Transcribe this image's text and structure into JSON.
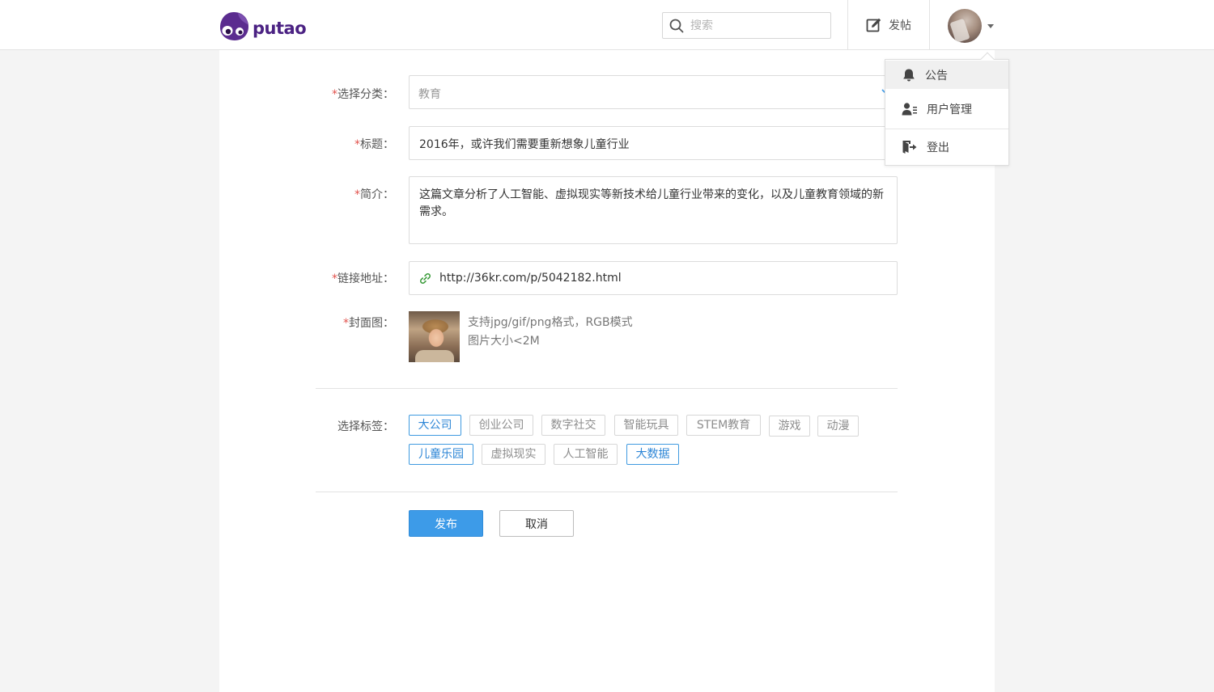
{
  "header": {
    "logo_text": "putao",
    "search_placeholder": "搜索",
    "post_label": "发帖"
  },
  "dropdown": {
    "items": [
      {
        "label": "公告",
        "icon": "bell-icon"
      },
      {
        "label": "用户管理",
        "icon": "user-manage-icon"
      },
      {
        "label": "登出",
        "icon": "logout-icon"
      }
    ]
  },
  "form": {
    "category": {
      "label": "选择分类：",
      "value": "教育"
    },
    "title": {
      "label": "标题：",
      "value": "2016年，或许我们需要重新想象儿童行业"
    },
    "summary": {
      "label": "简介：",
      "value": "这篇文章分析了人工智能、虚拟现实等新技术给儿童行业带来的变化，以及儿童教育领域的新需求。"
    },
    "link": {
      "label": "链接地址：",
      "value": "http://36kr.com/p/5042182.html"
    },
    "cover": {
      "label": "封面图：",
      "hint_line1": "支持jpg/gif/png格式，RGB模式",
      "hint_line2": "图片大小<2M"
    },
    "required_mark": "*",
    "tags_label": "选择标签：",
    "tags": [
      {
        "label": "大公司",
        "selected": true
      },
      {
        "label": "创业公司",
        "selected": false
      },
      {
        "label": "数字社交",
        "selected": false
      },
      {
        "label": "智能玩具",
        "selected": false
      },
      {
        "label": "STEM教育",
        "selected": false
      },
      {
        "label": "游戏",
        "selected": false
      },
      {
        "label": "动漫",
        "selected": false
      },
      {
        "label": "儿童乐园",
        "selected": true
      },
      {
        "label": "虚拟现实",
        "selected": false
      },
      {
        "label": "人工智能",
        "selected": false
      },
      {
        "label": "大数据",
        "selected": true
      }
    ],
    "submit_label": "发布",
    "cancel_label": "取消"
  },
  "colors": {
    "accent": "#3d9be8",
    "brand": "#4b2283",
    "required": "#e2524d",
    "link_icon": "#3a9b3a"
  }
}
